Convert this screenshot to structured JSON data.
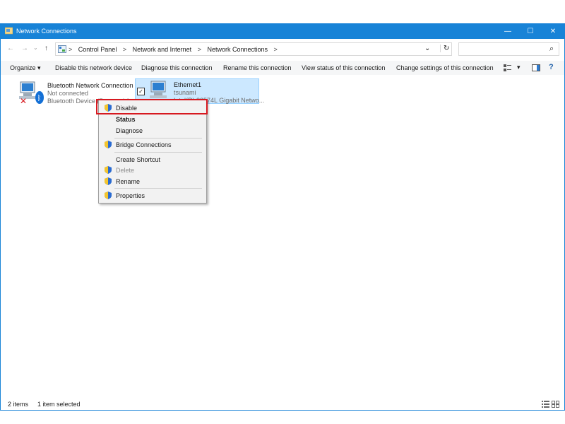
{
  "window": {
    "title": "Network Connections",
    "controls": {
      "minimize": "—",
      "maximize": "☐",
      "close": "✕"
    }
  },
  "address": {
    "crumbs": [
      "Control Panel",
      "Network and Internet",
      "Network Connections"
    ],
    "separator": ">",
    "dropdown": "⌄",
    "refresh": "↻",
    "search_icon": "⌕"
  },
  "toolbar": {
    "organize": "Organize",
    "organize_arrow": "▾",
    "disable_device": "Disable this network device",
    "diagnose": "Diagnose this connection",
    "rename": "Rename this connection",
    "view_status": "View status of this connection",
    "change_settings": "Change settings of this connection"
  },
  "connections": [
    {
      "name": "Bluetooth Network Connection",
      "status": "Not connected",
      "device": "Bluetooth Device (Personal Ar..."
    },
    {
      "name": "Ethernet1",
      "status": "tsunami",
      "device": "Intel(R) 82574L Gigabit Netwo..."
    }
  ],
  "context_menu": {
    "items": [
      {
        "label": "Disable",
        "shield": true,
        "state": "normal"
      },
      {
        "label": "Status",
        "shield": false,
        "state": "bold"
      },
      {
        "label": "Diagnose",
        "shield": false,
        "state": "normal"
      },
      {
        "label": "Bridge Connections",
        "shield": true,
        "state": "normal"
      },
      {
        "label": "Create Shortcut",
        "shield": false,
        "state": "normal"
      },
      {
        "label": "Delete",
        "shield": true,
        "state": "disabled"
      },
      {
        "label": "Rename",
        "shield": true,
        "state": "normal"
      },
      {
        "label": "Properties",
        "shield": true,
        "state": "normal"
      }
    ]
  },
  "status_bar": {
    "count": "2 items",
    "selected": "1 item selected"
  },
  "colors": {
    "titlebar": "#1883d7",
    "highlight": "#d71920",
    "selection": "#cce8ff"
  }
}
